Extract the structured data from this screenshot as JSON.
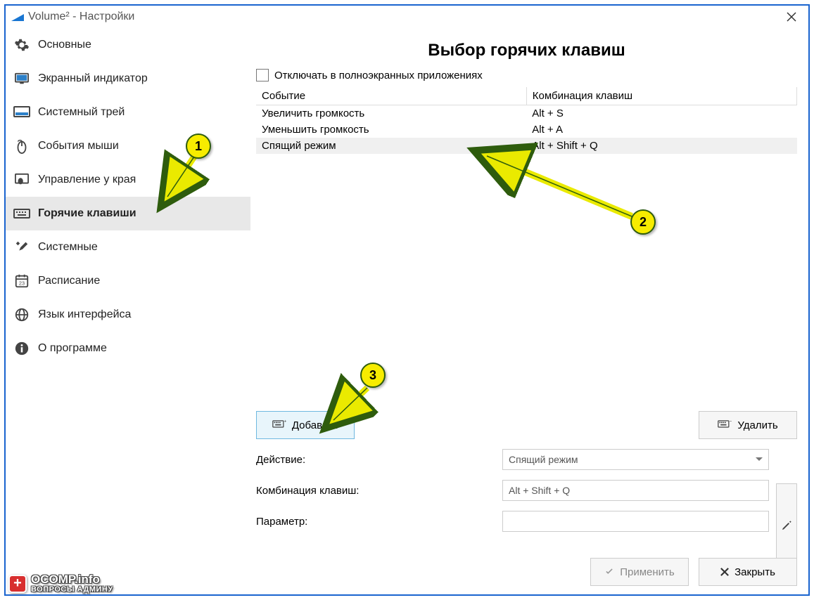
{
  "window": {
    "title": "Volume² - Настройки"
  },
  "sidebar": {
    "items": [
      {
        "label": "Основные",
        "icon": "gear-icon"
      },
      {
        "label": "Экранный индикатор",
        "icon": "monitor-icon"
      },
      {
        "label": "Системный трей",
        "icon": "tray-icon"
      },
      {
        "label": "События мыши",
        "icon": "mouse-icon"
      },
      {
        "label": "Управление у края",
        "icon": "edge-icon"
      },
      {
        "label": "Горячие клавиши",
        "icon": "keyboard-icon",
        "active": true
      },
      {
        "label": "Системные",
        "icon": "tools-icon"
      },
      {
        "label": "Расписание",
        "icon": "calendar-icon"
      },
      {
        "label": "Язык интерфейса",
        "icon": "globe-icon"
      },
      {
        "label": "О программе",
        "icon": "info-icon"
      }
    ]
  },
  "content": {
    "title": "Выбор горячих клавиш",
    "checkbox_label": "Отключать в полноэкранных приложениях",
    "table": {
      "headers": [
        "Событие",
        "Комбинация клавиш"
      ],
      "rows": [
        {
          "event": "Увеличить громкость",
          "keys": "Alt + S"
        },
        {
          "event": "Уменьшить громкость",
          "keys": "Alt + A"
        },
        {
          "event": "Спящий режим",
          "keys": "Alt + Shift + Q"
        }
      ]
    },
    "add_btn": "Добавить",
    "del_btn": "Удалить",
    "form": {
      "action_label": "Действие:",
      "action_value": "Спящий режим",
      "combo_label": "Комбинация клавиш:",
      "combo_value": "Alt + Shift + Q",
      "param_label": "Параметр:",
      "param_value": ""
    }
  },
  "footer": {
    "apply": "Применить",
    "close": "Закрыть"
  },
  "callouts": {
    "c1": "1",
    "c2": "2",
    "c3": "3"
  },
  "watermark": {
    "line1": "OCOMP.info",
    "line2": "ВОПРОСЫ АДМИНУ"
  }
}
